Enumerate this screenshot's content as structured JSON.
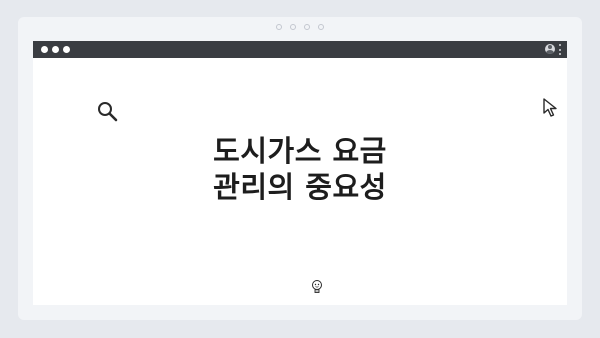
{
  "headline": {
    "line1": "도시가스 요금",
    "line2": "관리의 중요성"
  },
  "icons": {
    "search": "search-icon",
    "cursor": "cursor-icon",
    "mascot": "lightbulb-face-icon",
    "profile": "profile-icon",
    "menu": "kebab-menu-icon"
  },
  "colors": {
    "background": "#e6e9ee",
    "frame": "#f2f4f7",
    "titlebar": "#3a3d42",
    "content": "#ffffff",
    "text": "#1d1d1d"
  }
}
